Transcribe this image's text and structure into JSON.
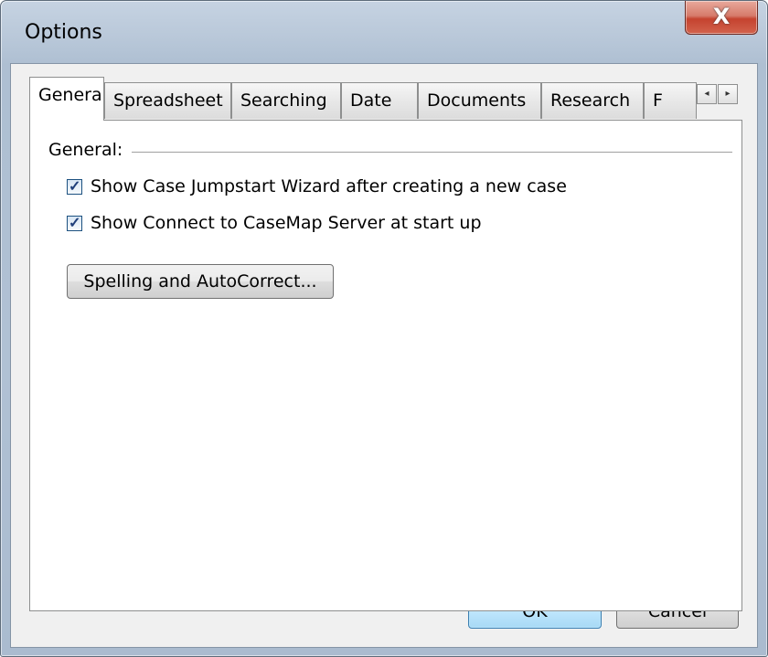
{
  "window": {
    "title": "Options",
    "close_glyph": "X"
  },
  "tabs": [
    {
      "label": "General",
      "active": true
    },
    {
      "label": "Spreadsheet",
      "active": false
    },
    {
      "label": "Searching",
      "active": false
    },
    {
      "label": "Date",
      "active": false
    },
    {
      "label": "Documents",
      "active": false
    },
    {
      "label": "Research",
      "active": false
    },
    {
      "label": "F",
      "active": false
    }
  ],
  "tab_scroll": {
    "left_icon": "◂",
    "right_icon": "▸"
  },
  "general": {
    "group_label": "General:",
    "options": [
      {
        "label": "Show Case Jumpstart Wizard after creating a new case",
        "checked": true
      },
      {
        "label": "Show Connect to CaseMap Server at start up",
        "checked": true
      }
    ],
    "spelling_button": "Spelling and AutoCorrect..."
  },
  "buttons": {
    "ok": "OK",
    "cancel": "Cancel"
  },
  "colors": {
    "frame": "#b9c8d9",
    "close": "#c5432f",
    "ok_accent": "#3c7fb1"
  }
}
